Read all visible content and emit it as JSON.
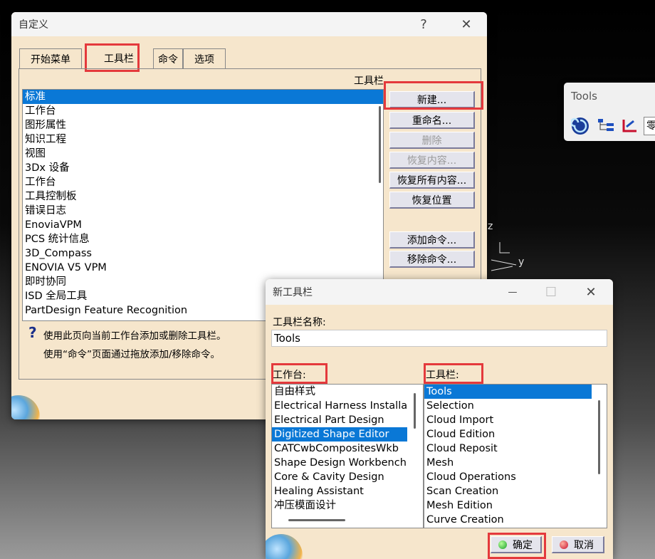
{
  "customize": {
    "title": "自定义",
    "help_btn": "?",
    "close_btn": "✕",
    "tabs": [
      "开始菜单",
      "工具栏",
      "命令",
      "选项"
    ],
    "list_header": "工具栏",
    "toolbars": [
      "标准",
      "工作台",
      "图形属性",
      "知识工程",
      "视图",
      "3Dx 设备",
      "工作台",
      "工具控制板",
      "错误日志",
      "EnoviaVPM",
      "PCS 统计信息",
      "3D_Compass",
      "ENOVIA V5 VPM",
      "即时协同",
      "ISD 全局工具",
      "PartDesign Feature Recognition"
    ],
    "buttons": {
      "new": "新建...",
      "rename": "重命名...",
      "delete": "删除",
      "restore_contents": "恢复内容...",
      "restore_all": "恢复所有内容...",
      "restore_position": "恢复位置",
      "add_commands": "添加命令...",
      "remove_commands": "移除命令..."
    },
    "help_text1": "使用此页向当前工作台添加或删除工具栏。",
    "help_text2": "使用“命令”页面通过拖放添加/移除命令。"
  },
  "tools_toolbar": {
    "title": "Tools",
    "partial_text": "零"
  },
  "axis": {
    "z": "z",
    "y": "y"
  },
  "new_toolbar": {
    "title": "新工具栏",
    "min_btn": "—",
    "max_btn": "☐",
    "close_btn": "✕",
    "name_label": "工具栏名称:",
    "name_value": "Tools",
    "workbench_label": "工作台:",
    "toolbar_label": "工具栏:",
    "workbenches": [
      "自由样式",
      "Electrical Harness Installat",
      "Electrical Part Design",
      "Digitized Shape Editor",
      "CATCwbCompositesWkb",
      "Shape Design Workbench",
      "Core & Cavity Design",
      "Healing Assistant",
      "冲压模面设计"
    ],
    "toolbars": [
      "Tools",
      "Selection",
      "Cloud Import",
      "Cloud Edition",
      "Cloud Reposit",
      "Mesh",
      "Cloud Operations",
      "Scan Creation",
      "Mesh Edition",
      "Curve Creation"
    ],
    "ok": "确定",
    "cancel": "取消"
  },
  "colors": {
    "dialog_bg": "#f6e6cc",
    "selection": "#0a78d6",
    "highlight_box": "#e4393c"
  }
}
